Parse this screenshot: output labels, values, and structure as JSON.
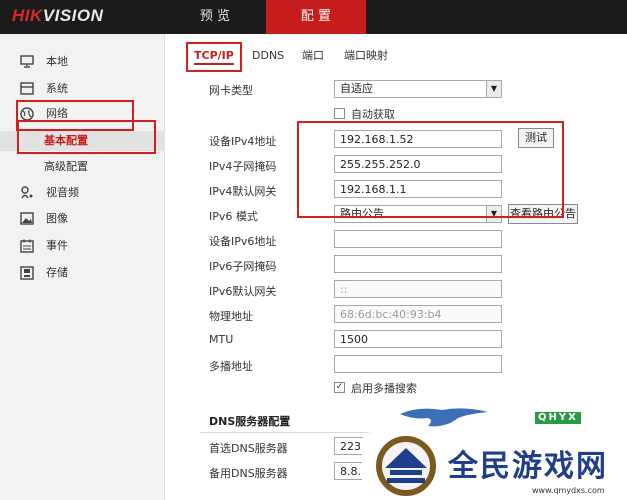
{
  "app": {
    "logo": "HIKVISION",
    "brand_color": "#c81d1d"
  },
  "nav": {
    "preview": "预 览",
    "config": "配 置"
  },
  "sidebar": {
    "items": [
      {
        "label": "本地",
        "icon": "monitor-icon"
      },
      {
        "label": "系统",
        "icon": "system-icon"
      },
      {
        "label": "网络",
        "icon": "globe-icon"
      },
      {
        "label": "基本配置"
      },
      {
        "label": "高级配置"
      },
      {
        "label": "视音频",
        "icon": "mic-icon"
      },
      {
        "label": "图像",
        "icon": "image-icon"
      },
      {
        "label": "事件",
        "icon": "calendar-icon"
      },
      {
        "label": "存储",
        "icon": "storage-icon"
      }
    ]
  },
  "tabs": [
    "TCP/IP",
    "DDNS",
    "端口",
    "端口映射"
  ],
  "form": {
    "nic_type": {
      "label": "网卡类型",
      "value": "自适应"
    },
    "dhcp": {
      "label": "自动获取",
      "checked": false
    },
    "ipv4_addr": {
      "label": "设备IPv4地址",
      "value": "192.168.1.52"
    },
    "test_button": "测试",
    "ipv4_mask": {
      "label": "IPv4子网掩码",
      "value": "255.255.252.0"
    },
    "ipv4_gw": {
      "label": "IPv4默认网关",
      "value": "192.168.1.1"
    },
    "ipv6_mode": {
      "label": "IPv6 模式",
      "value": "路由公告"
    },
    "view_route_button": "查看路由公告",
    "ipv6_addr": {
      "label": "设备IPv6地址",
      "value": ""
    },
    "ipv6_mask": {
      "label": "IPv6子网掩码",
      "value": ""
    },
    "ipv6_gw": {
      "label": "IPv6默认网关",
      "value": "::"
    },
    "mac": {
      "label": "物理地址",
      "value": "68:6d:bc:40:93:b4"
    },
    "mtu": {
      "label": "MTU",
      "value": "1500"
    },
    "multicast": {
      "label": "多播地址",
      "value": ""
    },
    "multicast_search": {
      "label": "启用多播搜索",
      "checked": true
    }
  },
  "dns": {
    "title": "DNS服务器配置",
    "primary": {
      "label": "首选DNS服务器",
      "value": "223."
    },
    "secondary": {
      "label": "备用DNS服务器",
      "value": "8.8."
    }
  },
  "watermark": {
    "text": "全民游戏网",
    "url": "www.qmydxs.com",
    "tag": "QHYX"
  }
}
